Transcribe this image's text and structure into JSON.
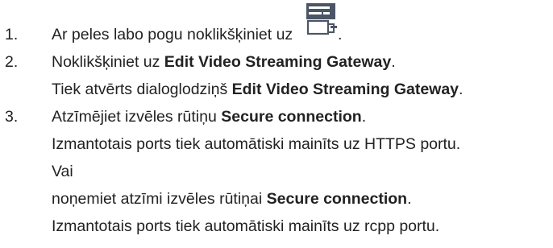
{
  "steps": [
    {
      "number": "1.",
      "text_before": "Ar peles labo pogu noklikšķiniet uz",
      "icon": "gateway-device-icon",
      "text_after": "."
    },
    {
      "number": "2.",
      "text_before": "Noklikšķiniet uz ",
      "bold": "Edit Video Streaming Gateway",
      "text_after": ".",
      "sub_before": "Tiek atvērts dialoglodziņš ",
      "sub_bold": "Edit Video Streaming Gateway",
      "sub_after": "."
    },
    {
      "number": "3.",
      "text_before": "Atzīmējiet izvēles rūtiņu ",
      "bold": "Secure connection",
      "text_after": ".",
      "line2": "Izmantotais ports tiek automātiski mainīts uz HTTPS portu.",
      "line3": "Vai",
      "line4_before": "noņemiet atzīmi izvēles rūtiņai ",
      "line4_bold": "Secure connection",
      "line4_after": ".",
      "line5": "Izmantotais ports tiek automātiski mainīts uz rcpp portu."
    }
  ],
  "colors": {
    "text": "#222222",
    "icon_dark": "#4a5566",
    "icon_light": "#ffffff"
  }
}
